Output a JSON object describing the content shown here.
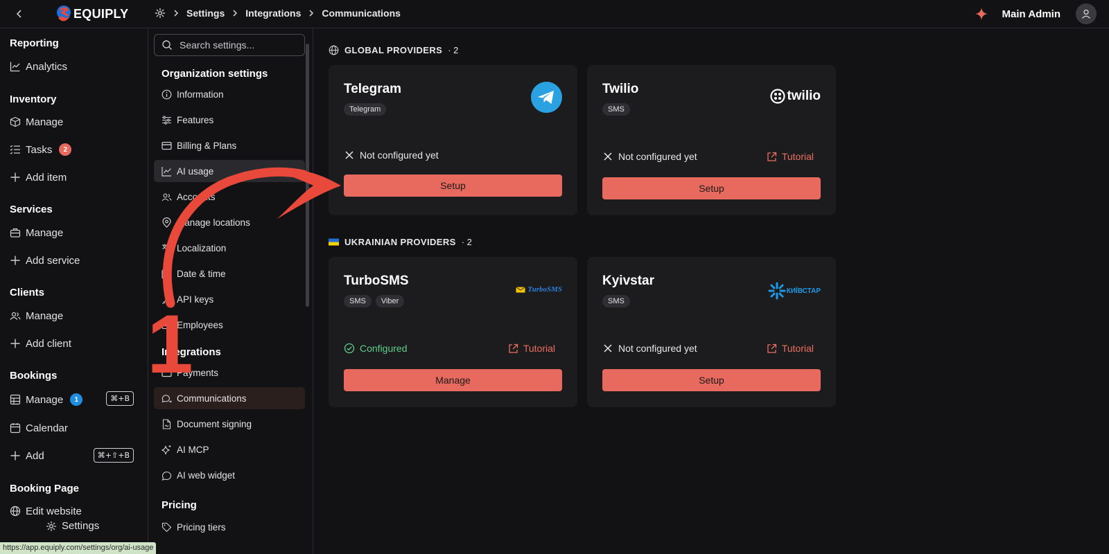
{
  "topbar": {
    "logo_text": "EQUIPLY",
    "breadcrumbs": [
      "Settings",
      "Integrations",
      "Communications"
    ],
    "user_name": "Main Admin"
  },
  "leftnav": {
    "sections": {
      "reporting": "Reporting",
      "inventory": "Inventory",
      "services": "Services",
      "clients": "Clients",
      "bookings": "Bookings",
      "booking_page": "Booking Page"
    },
    "items": {
      "analytics": "Analytics",
      "inventory_manage": "Manage",
      "tasks": "Tasks",
      "tasks_badge": "2",
      "add_item": "Add item",
      "services_manage": "Manage",
      "add_service": "Add service",
      "clients_manage": "Manage",
      "add_client": "Add client",
      "bookings_manage": "Manage",
      "bookings_badge": "1",
      "bookings_shortcut": "⌘+B",
      "calendar": "Calendar",
      "add": "Add",
      "add_shortcut": "⌘+⇧+B",
      "edit_website": "Edit website",
      "settings": "Settings"
    },
    "status_url": "https://app.equiply.com/settings/org/ai-usage",
    "colors": {
      "tasks_badge": "#e8695d",
      "bookings_badge": "#1e8fe0"
    }
  },
  "settings": {
    "search_placeholder": "Search settings...",
    "org_section": "Organization settings",
    "org_items": [
      "Information",
      "Features",
      "Billing & Plans",
      "AI usage",
      "Accounts",
      "Manage locations",
      "Localization",
      "Date & time",
      "API keys",
      "Employees"
    ],
    "integrations_section": "Integrations",
    "integration_items": [
      "Payments",
      "Communications",
      "Document signing",
      "AI MCP",
      "AI web widget"
    ],
    "pricing_section": "Pricing",
    "pricing_items": [
      "Pricing tiers"
    ]
  },
  "main": {
    "global": {
      "title": "GLOBAL PROVIDERS",
      "count": "· 2",
      "cards": [
        {
          "name": "Telegram",
          "tags": [
            "Telegram"
          ],
          "status": "Not configured yet",
          "tutorial": "",
          "button": "Setup"
        },
        {
          "name": "Twilio",
          "tags": [
            "SMS"
          ],
          "status": "Not configured yet",
          "tutorial": "Tutorial",
          "button": "Setup",
          "logo_text": "twilio"
        }
      ]
    },
    "ukrainian": {
      "title": "UKRAINIAN PROVIDERS",
      "count": "· 2",
      "cards": [
        {
          "name": "TurboSMS",
          "tags": [
            "SMS",
            "Viber"
          ],
          "status": "Configured",
          "tutorial": "Tutorial",
          "button": "Manage",
          "logo_text": "TurboSMS"
        },
        {
          "name": "Kyivstar",
          "tags": [
            "SMS"
          ],
          "status": "Not configured yet",
          "tutorial": "Tutorial",
          "button": "Setup",
          "logo_text": "КИЇВСТАР"
        }
      ]
    }
  },
  "annotation": {
    "step_number": "1",
    "color": "#e8493a"
  },
  "colors": {
    "accent": "#e8695d",
    "configured": "#5ecf8a",
    "background": "#121214",
    "card": "#1c1c1f"
  }
}
